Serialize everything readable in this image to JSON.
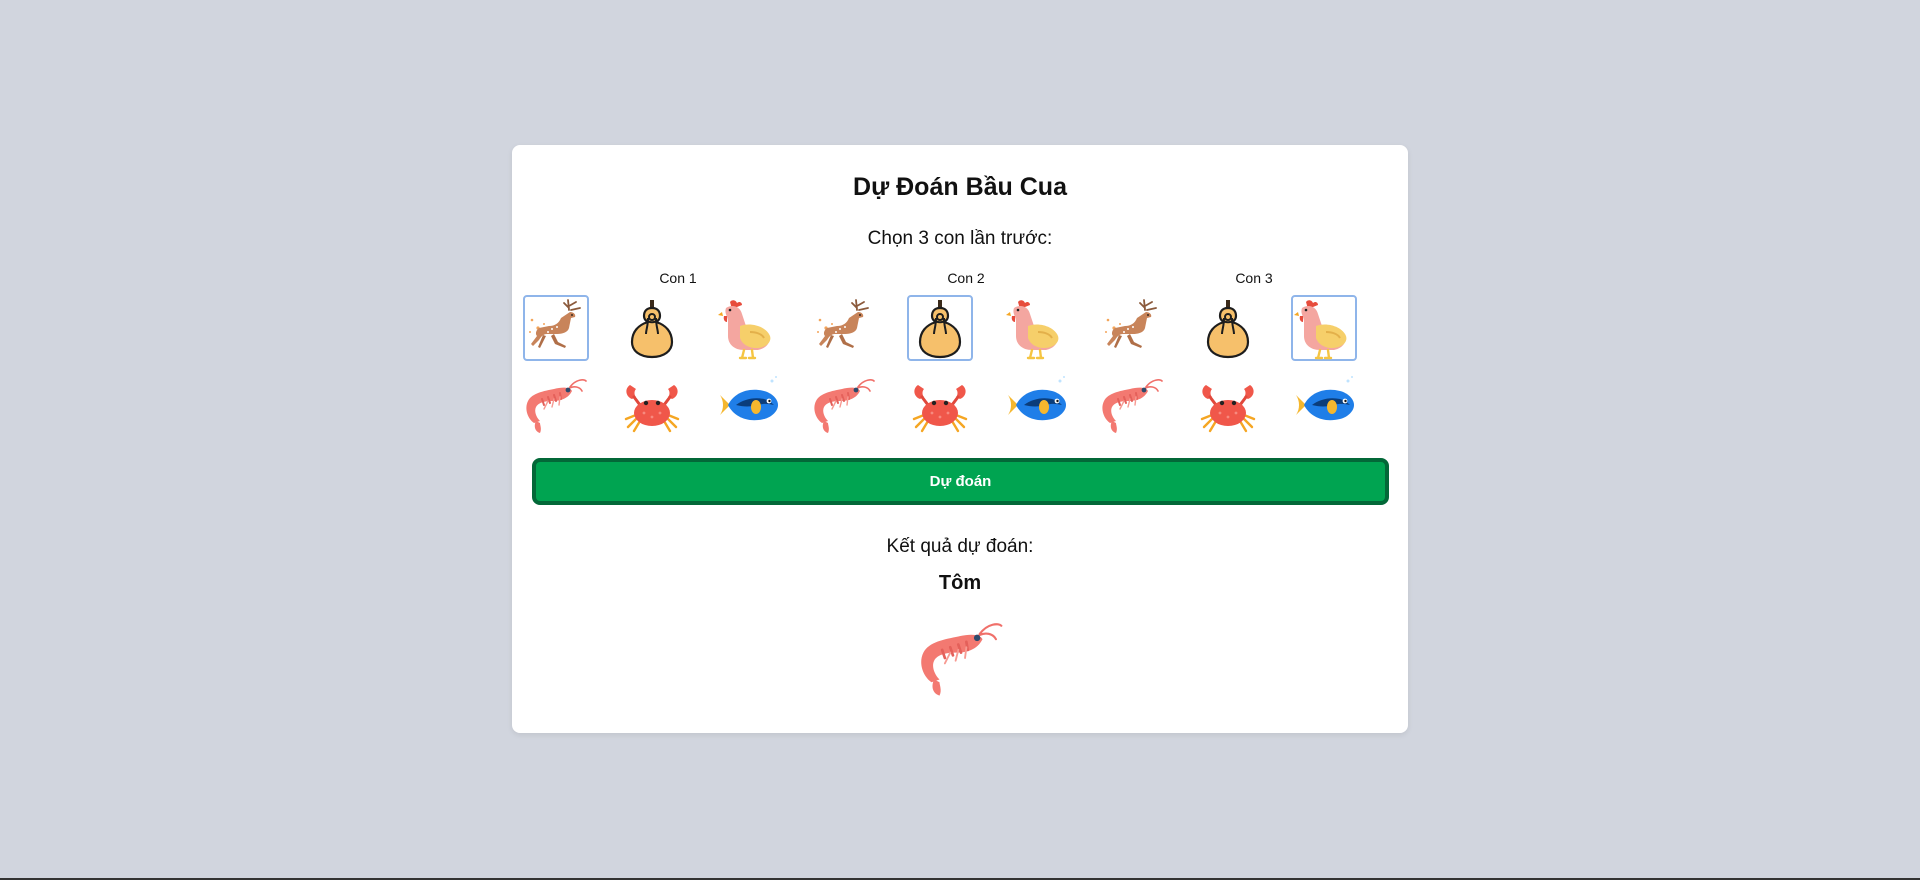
{
  "title": "Dự Đoán Bầu Cua",
  "subtitle": "Chọn 3 con lần trước:",
  "groups": [
    {
      "label": "Con 1",
      "selected": "nai"
    },
    {
      "label": "Con 2",
      "selected": "bau"
    },
    {
      "label": "Con 3",
      "selected": "ga"
    }
  ],
  "animals": [
    {
      "id": "nai",
      "icon": "deer-icon"
    },
    {
      "id": "bau",
      "icon": "gourd-icon"
    },
    {
      "id": "ga",
      "icon": "rooster-icon"
    },
    {
      "id": "tom",
      "icon": "shrimp-icon"
    },
    {
      "id": "cua",
      "icon": "crab-icon"
    },
    {
      "id": "ca",
      "icon": "fish-icon"
    }
  ],
  "predict_button": "Dự đoán",
  "result": {
    "label": "Kết quả dự đoán:",
    "name": "Tôm",
    "icon": "shrimp-icon"
  }
}
